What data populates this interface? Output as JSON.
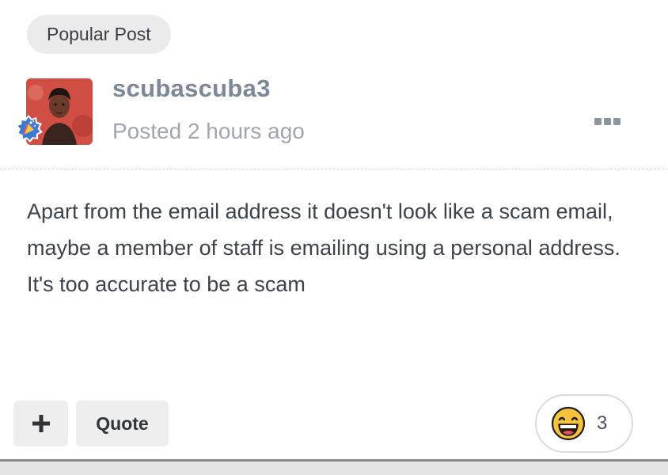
{
  "post": {
    "badge": "Popular Post",
    "author": "scubascuba3",
    "posted": "Posted 2 hours ago",
    "body": "Apart from the email address it doesn't look like a scam email, maybe a member of staff is emailing using a personal address. It's too accurate to be a scam",
    "icons": {
      "avatar": "user-avatar-photo",
      "rank": "rank-badge-icon",
      "menu": "more-options-icon"
    }
  },
  "actions": {
    "plus_label": "+",
    "quote_label": "Quote"
  },
  "reaction": {
    "icon": "grinning-face-emoji",
    "count": "3"
  },
  "colors": {
    "author": "#7c8898",
    "badge_bg": "#ebebeb",
    "button_bg": "#eeeeee",
    "avatar_bg": "#c8453c"
  }
}
